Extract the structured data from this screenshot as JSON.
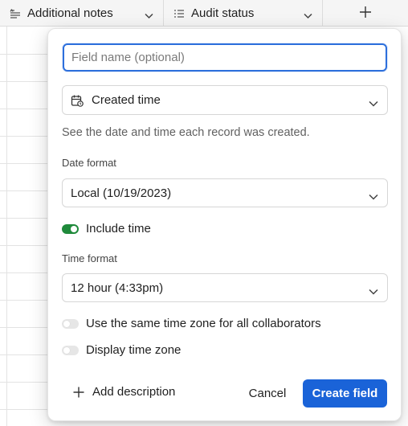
{
  "grid": {
    "columns": [
      {
        "label": "Additional notes",
        "icon": "long-text-icon"
      },
      {
        "label": "Audit status",
        "icon": "single-select-icon"
      }
    ],
    "add_column_icon": "plus-icon"
  },
  "dialog": {
    "name_placeholder": "Field name (optional)",
    "name_value": "",
    "field_type": {
      "label": "Created time",
      "icon": "calendar-icon"
    },
    "description": "See the date and time each record was created.",
    "date_format": {
      "label": "Date format",
      "value": "Local (10/19/2023)"
    },
    "include_time": {
      "label": "Include time",
      "on": true
    },
    "time_format": {
      "label": "Time format",
      "value": "12 hour (4:33pm)"
    },
    "same_time_zone": {
      "label": "Use the same time zone for all collaborators",
      "on": false
    },
    "display_time_zone": {
      "label": "Display time zone",
      "on": false
    },
    "add_description_label": "Add description",
    "cancel_label": "Cancel",
    "create_label": "Create field"
  },
  "colors": {
    "primary": "#1a63d8",
    "toggle_on": "#1f8a3b",
    "focus_border": "#2d6fdc"
  }
}
